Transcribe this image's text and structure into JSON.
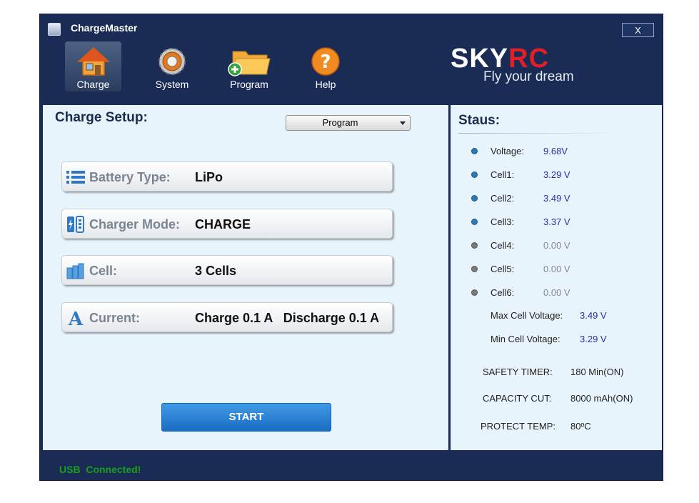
{
  "window": {
    "title": "ChargeMaster",
    "close_label": "X"
  },
  "toolbar": {
    "items": [
      {
        "label": "Charge",
        "icon": "house-icon"
      },
      {
        "label": "System",
        "icon": "gear-icon"
      },
      {
        "label": "Program",
        "icon": "folder-add-icon"
      },
      {
        "label": "Help",
        "icon": "help-icon"
      }
    ]
  },
  "brand": {
    "logo_sky": "SKY",
    "logo_rc": "RC",
    "tagline": "Fly your dream"
  },
  "setup": {
    "title": "Charge Setup:",
    "program_select": "Program",
    "rows": [
      {
        "label": "Battery Type:",
        "value": "LiPo",
        "icon": "list-icon"
      },
      {
        "label": "Charger Mode:",
        "value": "CHARGE",
        "icon": "battery-mode-icon"
      },
      {
        "label": "Cell:",
        "value": "3 Cells",
        "icon": "cells-icon"
      },
      {
        "label": "Current:",
        "value": "Charge 0.1 A   Discharge 0.1 A",
        "icon": "current-icon"
      }
    ],
    "start_label": "START"
  },
  "status": {
    "title": "Staus:",
    "rows": [
      {
        "label": "Voltage:",
        "value": "9.68V",
        "active": true
      },
      {
        "label": "Cell1:",
        "value": "3.29 V",
        "active": true
      },
      {
        "label": "Cell2:",
        "value": "3.49 V",
        "active": true
      },
      {
        "label": "Cell3:",
        "value": "3.37 V",
        "active": true
      },
      {
        "label": "Cell4:",
        "value": "0.00 V",
        "active": false
      },
      {
        "label": "Cell5:",
        "value": "0.00 V",
        "active": false
      },
      {
        "label": "Cell6:",
        "value": "0.00 V",
        "active": false
      }
    ],
    "max_cell_label": "Max Cell Voltage:",
    "max_cell_value": "3.49 V",
    "min_cell_label": "Min Cell Voltage:",
    "min_cell_value": "3.29 V",
    "safety_label": "SAFETY TIMER:",
    "safety_value": "180 Min(ON)",
    "capacity_label": "CAPACITY CUT:",
    "capacity_value": "8000 mAh(ON)",
    "protect_label": "PROTECT TEMP:",
    "protect_value": "80ºC"
  },
  "statusbar": {
    "text": "USB  Connected!"
  },
  "colors": {
    "window_bg": "#1a2c55",
    "panel_bg": "#e8f4fb",
    "accent": "#1a6cc2",
    "value_blue": "#2b2ea8",
    "logo_red": "#e01f26",
    "usb_green": "#16a01c"
  }
}
